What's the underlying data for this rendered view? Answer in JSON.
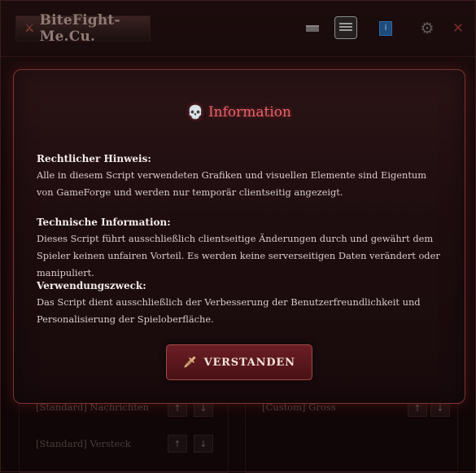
{
  "app": {
    "logo_text": "BiteFight-Me.Cu."
  },
  "toolbar": {
    "icons": [
      "minimize-icon",
      "list-icon",
      "info-icon",
      "gear-icon",
      "close-icon"
    ],
    "close_glyph": "✕",
    "gear_glyph": "⚙",
    "info_glyph": "i"
  },
  "background": {
    "rows": [
      {
        "label": "[Standard] Nachrichten",
        "up": "↑",
        "down": "↓"
      },
      {
        "label": "[Standard] Versteck",
        "up": "↑",
        "down": "↓"
      },
      {
        "label": "[Custom] Gross",
        "up": "↑",
        "down": "↓"
      }
    ]
  },
  "dialog": {
    "icon": "💀",
    "title": "Information",
    "sections": [
      {
        "heading": "Rechtlicher Hinweis:",
        "text": "Alle in diesem Script verwendeten Grafiken und visuellen Elemente sind Eigentum von GameForge und werden nur temporär clientseitig angezeigt."
      },
      {
        "heading": "Technische Information:",
        "text": "Dieses Script führt ausschließlich clientseitige Änderungen durch und gewährt dem Spieler keinen unfairen Vorteil. Es werden keine serverseitigen Daten verändert oder manipuliert."
      },
      {
        "heading": "Verwendungszweck:",
        "text": "Das Script dient ausschließlich der Verbesserung der Benutzerfreundlichkeit und Personalisierung der Spieloberfläche."
      }
    ],
    "button_icon": "🗡",
    "button_label": "VERSTANDEN"
  },
  "colors": {
    "accent": "#e8636a",
    "border": "#7a3434",
    "button_bg": "#5a161c"
  }
}
